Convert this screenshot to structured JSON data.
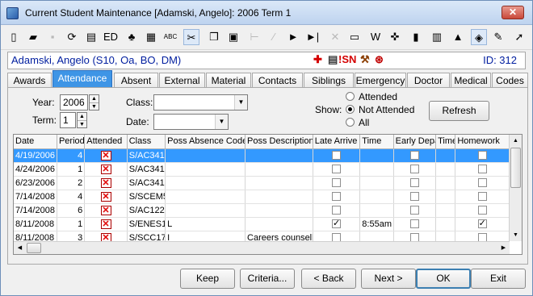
{
  "window": {
    "title": "Current Student Maintenance  [Adamski, Angelo]: 2006 Term 1",
    "close_label": "✕"
  },
  "toolbar": {
    "buttons": [
      {
        "icon": "new-document-icon",
        "glyph": "▯"
      },
      {
        "icon": "open-folder-icon",
        "glyph": "▰"
      },
      {
        "icon": "save-icon",
        "glyph": "▪"
      },
      {
        "icon": "refresh-icon",
        "glyph": "⟳"
      },
      {
        "icon": "print-icon",
        "glyph": "▤"
      },
      {
        "icon": "ed-icon",
        "glyph": "ED"
      },
      {
        "icon": "tree-icon",
        "glyph": "♣"
      },
      {
        "icon": "calculator-icon",
        "glyph": "▦"
      },
      {
        "icon": "spellcheck-icon",
        "glyph": "ABC"
      },
      {
        "icon": "cut-icon",
        "glyph": "✂"
      },
      {
        "icon": "copy-icon",
        "glyph": "❐"
      },
      {
        "icon": "paste-icon",
        "glyph": "▣"
      },
      {
        "icon": "first-icon",
        "glyph": "⊢"
      },
      {
        "icon": "prev-icon",
        "glyph": "∕"
      },
      {
        "icon": "play-icon",
        "glyph": "►"
      },
      {
        "icon": "last-icon",
        "glyph": "►|"
      },
      {
        "icon": "delete-icon",
        "glyph": "✕"
      },
      {
        "icon": "table-icon",
        "glyph": "▭"
      },
      {
        "icon": "word-icon",
        "glyph": "W"
      },
      {
        "icon": "puzzle-icon",
        "glyph": "✜"
      },
      {
        "icon": "clipboard-icon",
        "glyph": "▮"
      },
      {
        "icon": "barcode-icon",
        "glyph": "▥"
      },
      {
        "icon": "stamp-icon",
        "glyph": "▲"
      },
      {
        "icon": "tag-icon",
        "glyph": "◈"
      },
      {
        "icon": "edit-icon",
        "glyph": "✎"
      },
      {
        "icon": "arrow-icon",
        "glyph": "➚"
      }
    ]
  },
  "student": {
    "name": "Adamski, Angelo (S10, Oa, BO, DM)",
    "id": "ID: 312",
    "flags": {
      "medical": "✚",
      "notes": "▤",
      "sn": "!SN",
      "discipline": "⚒",
      "other": "⊛"
    }
  },
  "tabs": [
    "Awards",
    "Attendance",
    "Absent",
    "External",
    "Material",
    "Contacts",
    "Siblings",
    "Emergency",
    "Doctor",
    "Medical",
    "Codes"
  ],
  "filters": {
    "year_label": "Year:",
    "year_value": "2006",
    "term_label": "Term:",
    "term_value": "1",
    "class_label": "Class:",
    "class_value": "",
    "date_label": "Date:",
    "date_value": "",
    "show_label": "Show:",
    "show_options": [
      "Attended",
      "Not Attended",
      "All"
    ],
    "show_selected": "Not Attended",
    "refresh_label": "Refresh"
  },
  "table": {
    "columns": [
      "Date",
      "Period",
      "Attended",
      "Class",
      "Poss Absence Code",
      "Poss Description",
      "Late Arrive",
      "Time",
      "Early Depart",
      "Time",
      "Homework"
    ],
    "rows": [
      {
        "date": "4/19/2006",
        "period": "4",
        "attended": false,
        "class": "S/AC341",
        "code": "",
        "description": "",
        "late": false,
        "time": "",
        "early": false,
        "time2": "",
        "homework": false
      },
      {
        "date": "4/24/2006",
        "period": "1",
        "attended": false,
        "class": "S/AC341",
        "code": "",
        "description": "",
        "late": false,
        "time": "",
        "early": false,
        "time2": "",
        "homework": false
      },
      {
        "date": "6/23/2006",
        "period": "2",
        "attended": false,
        "class": "S/AC341",
        "code": "",
        "description": "",
        "late": false,
        "time": "",
        "early": false,
        "time2": "",
        "homework": false
      },
      {
        "date": "7/14/2008",
        "period": "4",
        "attended": false,
        "class": "S/SCEM5",
        "code": "",
        "description": "",
        "late": false,
        "time": "",
        "early": false,
        "time2": "",
        "homework": false
      },
      {
        "date": "7/14/2008",
        "period": "6",
        "attended": false,
        "class": "S/AC122",
        "code": "",
        "description": "",
        "late": false,
        "time": "",
        "early": false,
        "time2": "",
        "homework": false
      },
      {
        "date": "8/11/2008",
        "period": "1",
        "attended": false,
        "class": "S/ENES1",
        "code": "L",
        "description": "",
        "late": true,
        "time": "8:55am",
        "early": false,
        "time2": "",
        "homework": true
      },
      {
        "date": "8/11/2008",
        "period": "3",
        "attended": false,
        "class": "S/SCC17",
        "code": "I",
        "description": "Careers counsello",
        "late": false,
        "time": "",
        "early": false,
        "time2": "",
        "homework": false
      }
    ]
  },
  "buttons": {
    "keep": "Keep",
    "criteria": "Criteria...",
    "back": "< Back",
    "next": "Next >",
    "ok": "OK",
    "exit": "Exit"
  }
}
